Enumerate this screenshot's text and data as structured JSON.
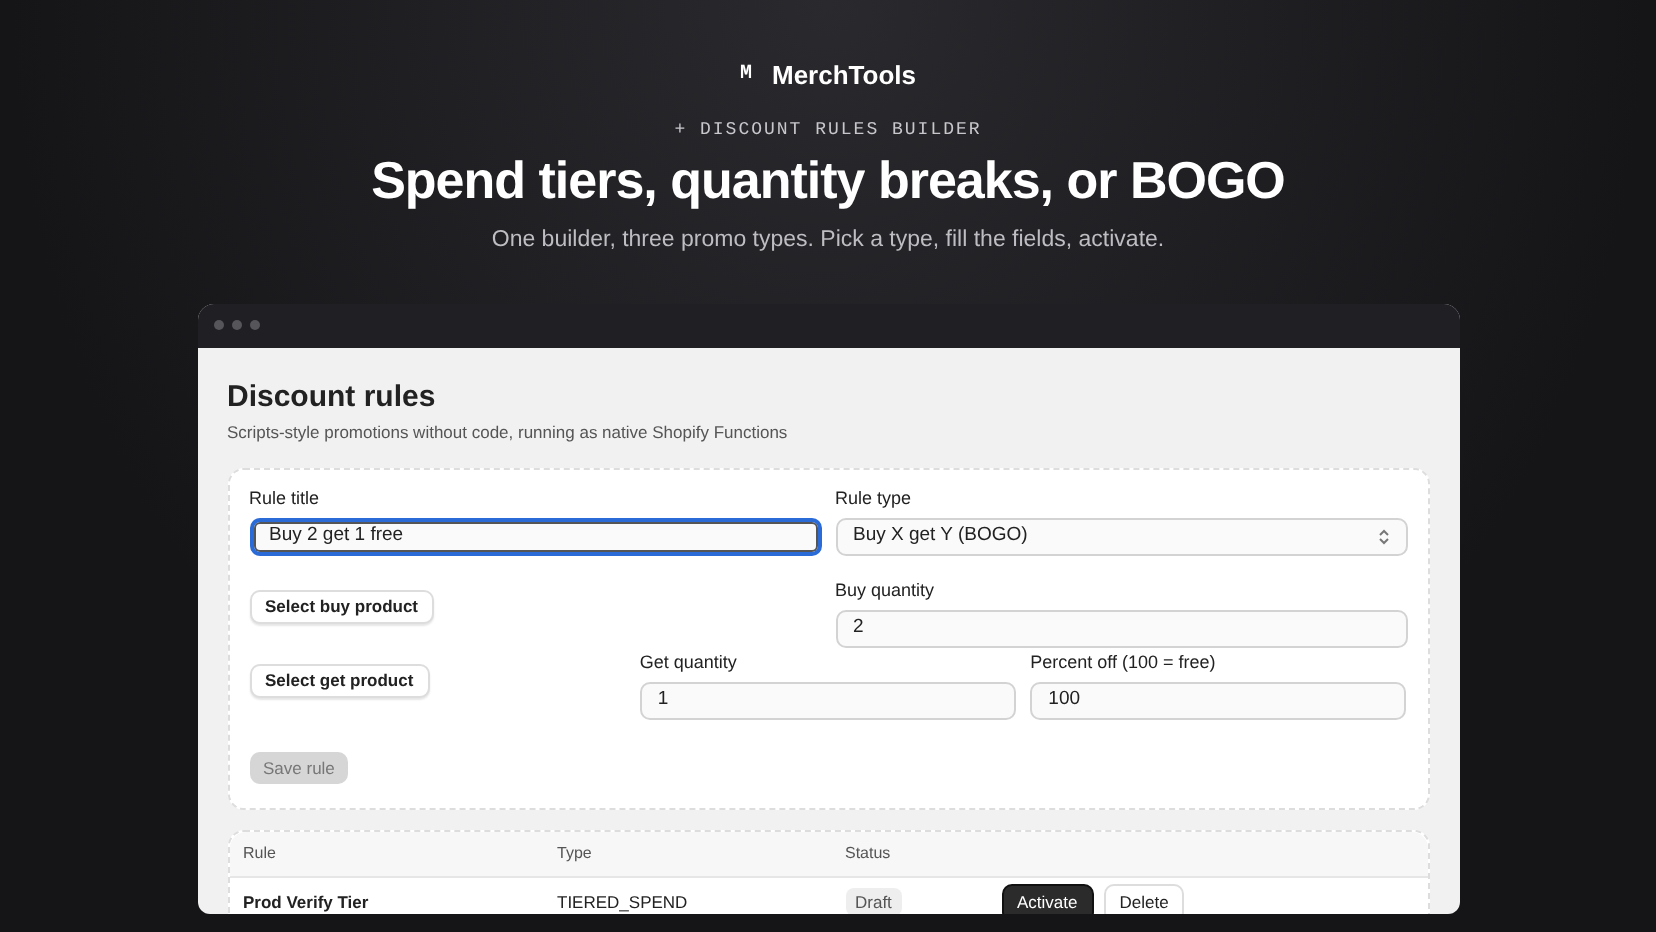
{
  "brand": {
    "name": "MerchTools",
    "logo_letter": "M"
  },
  "eyebrow": "+ DISCOUNT RULES BUILDER",
  "headline": "Spend tiers, quantity breaks, or BOGO",
  "subtitle": "One builder, three promo types. Pick a type, fill the fields, activate.",
  "window": {
    "title": "Discount rules",
    "subtitle": "Scripts-style promotions without code, running as native Shopify Functions"
  },
  "form": {
    "rule_title": {
      "label": "Rule title",
      "value": "Buy 2 get 1 free",
      "focused": true
    },
    "rule_type": {
      "label": "Rule type",
      "value": "Buy X get Y (BOGO)"
    },
    "select_buy_button": "Select buy product",
    "buy_quantity": {
      "label": "Buy quantity",
      "value": "2"
    },
    "select_get_button": "Select get product",
    "get_quantity": {
      "label": "Get quantity",
      "value": "1"
    },
    "percent_off": {
      "label": "Percent off (100 = free)",
      "value": "100"
    },
    "save_button": {
      "label": "Save rule",
      "disabled": true
    }
  },
  "table": {
    "columns": [
      "Rule",
      "Type",
      "Status"
    ],
    "rows": [
      {
        "rule": "Prod Verify Tier",
        "type": "TIERED_SPEND",
        "status": "Draft",
        "actions": [
          "Activate",
          "Delete"
        ]
      }
    ]
  }
}
